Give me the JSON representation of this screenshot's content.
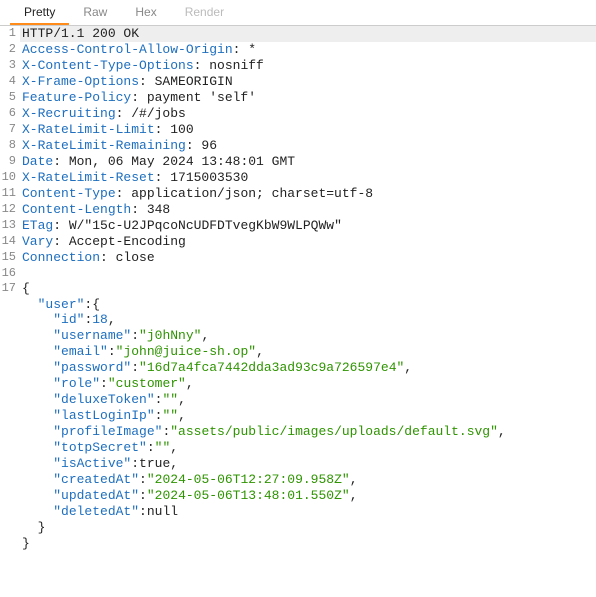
{
  "tabs": [
    {
      "label": "Pretty",
      "active": true
    },
    {
      "label": "Raw",
      "active": false
    },
    {
      "label": "Hex",
      "active": false
    },
    {
      "label": "Render",
      "active": false,
      "disabled": true
    }
  ],
  "lines": [
    {
      "n": 1,
      "type": "status",
      "text": "HTTP/1.1 200 OK"
    },
    {
      "n": 2,
      "type": "header",
      "key": "Access-Control-Allow-Origin",
      "value": " *"
    },
    {
      "n": 3,
      "type": "header",
      "key": "X-Content-Type-Options",
      "value": " nosniff"
    },
    {
      "n": 4,
      "type": "header",
      "key": "X-Frame-Options",
      "value": " SAMEORIGIN"
    },
    {
      "n": 5,
      "type": "header",
      "key": "Feature-Policy",
      "value": " payment 'self'"
    },
    {
      "n": 6,
      "type": "header",
      "key": "X-Recruiting",
      "value": " /#/jobs"
    },
    {
      "n": 7,
      "type": "header",
      "key": "X-RateLimit-Limit",
      "value": " 100"
    },
    {
      "n": 8,
      "type": "header",
      "key": "X-RateLimit-Remaining",
      "value": " 96"
    },
    {
      "n": 9,
      "type": "header",
      "key": "Date",
      "value": " Mon, 06 May 2024 13:48:01 GMT"
    },
    {
      "n": 10,
      "type": "header",
      "key": "X-RateLimit-Reset",
      "value": " 1715003530"
    },
    {
      "n": 11,
      "type": "header",
      "key": "Content-Type",
      "value": " application/json; charset=utf-8"
    },
    {
      "n": 12,
      "type": "header",
      "key": "Content-Length",
      "value": " 348"
    },
    {
      "n": 13,
      "type": "header",
      "key": "ETag",
      "value": " W/\"15c-U2JPqcoNcUDFDTvegKbW9WLPQWw\""
    },
    {
      "n": 14,
      "type": "header",
      "key": "Vary",
      "value": " Accept-Encoding"
    },
    {
      "n": 15,
      "type": "header",
      "key": "Connection",
      "value": " close"
    },
    {
      "n": 16,
      "type": "blank",
      "text": ""
    },
    {
      "n": 17,
      "type": "json",
      "text": "{"
    },
    {
      "n": 0,
      "type": "jsonrow",
      "indent": "  ",
      "key": "user",
      "post": ":{"
    },
    {
      "n": 0,
      "type": "jsonkv",
      "indent": "    ",
      "key": "id",
      "vtype": "num",
      "value": "18",
      "comma": ","
    },
    {
      "n": 0,
      "type": "jsonkv",
      "indent": "    ",
      "key": "username",
      "vtype": "str",
      "value": "j0hNny",
      "comma": ","
    },
    {
      "n": 0,
      "type": "jsonkv",
      "indent": "    ",
      "key": "email",
      "vtype": "str",
      "value": "john@juice-sh.op",
      "comma": ","
    },
    {
      "n": 0,
      "type": "jsonkv",
      "indent": "    ",
      "key": "password",
      "vtype": "str",
      "value": "16d7a4fca7442dda3ad93c9a726597e4",
      "comma": ","
    },
    {
      "n": 0,
      "type": "jsonkv",
      "indent": "    ",
      "key": "role",
      "vtype": "str",
      "value": "customer",
      "comma": ","
    },
    {
      "n": 0,
      "type": "jsonkv",
      "indent": "    ",
      "key": "deluxeToken",
      "vtype": "str",
      "value": "",
      "comma": ","
    },
    {
      "n": 0,
      "type": "jsonkv",
      "indent": "    ",
      "key": "lastLoginIp",
      "vtype": "str",
      "value": "",
      "comma": ","
    },
    {
      "n": 0,
      "type": "jsonkv",
      "indent": "    ",
      "key": "profileImage",
      "vtype": "str",
      "value": "assets/public/images/uploads/default.svg",
      "comma": ","
    },
    {
      "n": 0,
      "type": "jsonkv",
      "indent": "    ",
      "key": "totpSecret",
      "vtype": "str",
      "value": "",
      "comma": ","
    },
    {
      "n": 0,
      "type": "jsonkv",
      "indent": "    ",
      "key": "isActive",
      "vtype": "plain",
      "value": "true",
      "comma": ","
    },
    {
      "n": 0,
      "type": "jsonkv",
      "indent": "    ",
      "key": "createdAt",
      "vtype": "str",
      "value": "2024-05-06T12:27:09.958Z",
      "comma": ","
    },
    {
      "n": 0,
      "type": "jsonkv",
      "indent": "    ",
      "key": "updatedAt",
      "vtype": "str",
      "value": "2024-05-06T13:48:01.550Z",
      "comma": ","
    },
    {
      "n": 0,
      "type": "jsonkv",
      "indent": "    ",
      "key": "deletedAt",
      "vtype": "plain",
      "value": "null",
      "comma": ""
    },
    {
      "n": 0,
      "type": "json",
      "text": "  }"
    },
    {
      "n": 0,
      "type": "json",
      "text": "}"
    }
  ]
}
